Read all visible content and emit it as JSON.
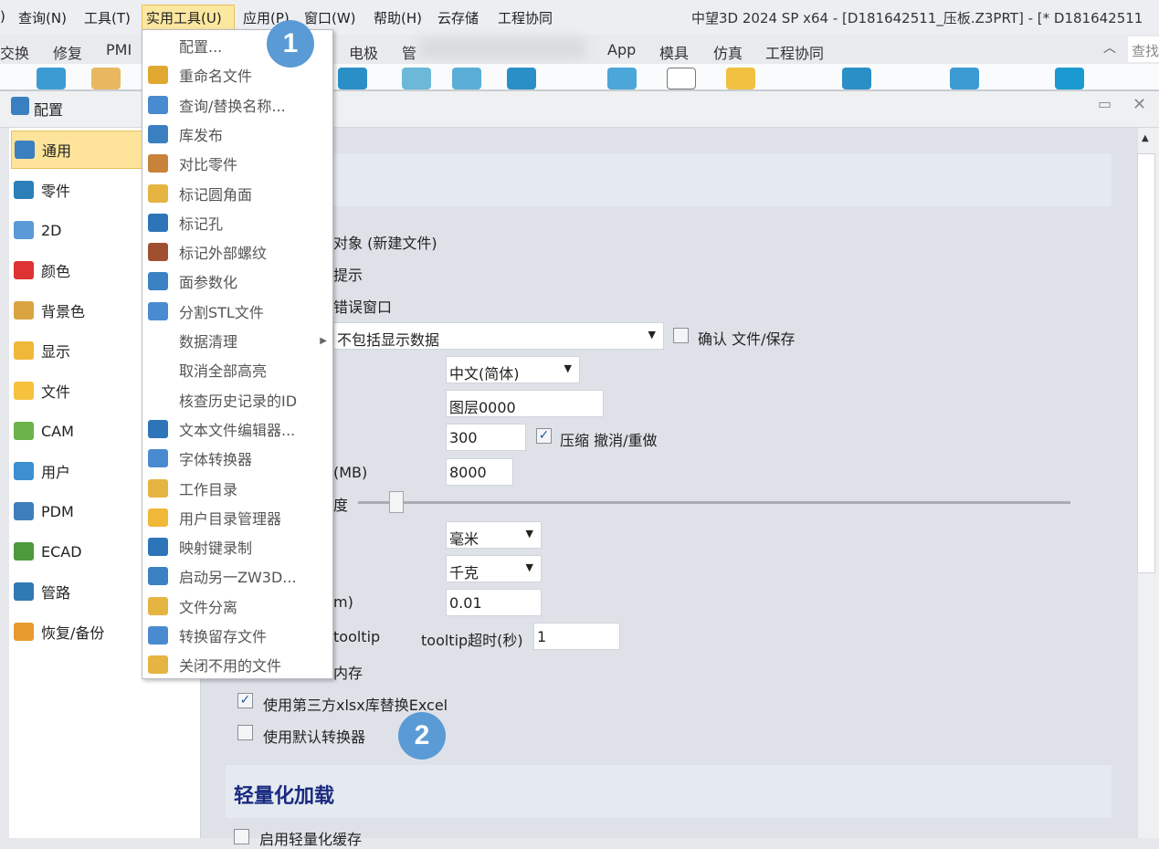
{
  "menubar": {
    "items": [
      ")",
      "查询(N)",
      "工具(T)",
      "实用工具(U)",
      "应用(P)",
      "窗口(W)",
      "帮助(H)",
      "云存储",
      "工程协同"
    ],
    "title": "中望3D 2024 SP x64 - [D181642511_压板.Z3PRT]  - [* D181642511"
  },
  "ribbon": {
    "tabs": [
      "交换",
      "修复",
      "PMI",
      "电极",
      "管",
      "App",
      "模具",
      "仿真",
      "工程协同"
    ],
    "search_placeholder": "查找"
  },
  "dialog": {
    "title": "配置"
  },
  "sidebar": {
    "items": [
      {
        "label": "通用",
        "icon": "general-icon",
        "color": "#3a7fc0"
      },
      {
        "label": "零件",
        "icon": "part-icon",
        "color": "#2b7fb8"
      },
      {
        "label": "2D",
        "icon": "2d-icon",
        "color": "#5a9ad6"
      },
      {
        "label": "颜色",
        "icon": "color-icon",
        "color": "#d33"
      },
      {
        "label": "背景色",
        "icon": "palette-icon",
        "color": "#d9a441"
      },
      {
        "label": "显示",
        "icon": "display-icon",
        "color": "#f0b838"
      },
      {
        "label": "文件",
        "icon": "folder-icon",
        "color": "#f6c23e"
      },
      {
        "label": "CAM",
        "icon": "cam-icon",
        "color": "#6bb34a"
      },
      {
        "label": "用户",
        "icon": "user-icon",
        "color": "#3c8fd0"
      },
      {
        "label": "PDM",
        "icon": "pdm-icon",
        "color": "#3d7fbd"
      },
      {
        "label": "ECAD",
        "icon": "ecad-icon",
        "color": "#4c9a3c"
      },
      {
        "label": "管路",
        "icon": "pipe-icon",
        "color": "#2f79b4"
      },
      {
        "label": "恢复/备份",
        "icon": "backup-icon",
        "color": "#e59b2d"
      }
    ]
  },
  "menu": {
    "items": [
      {
        "label": "配置...",
        "icon": ""
      },
      {
        "label": "重命名文件",
        "icon": "rename-icon",
        "color": "#e0a830"
      },
      {
        "label": "查询/替换名称...",
        "icon": "replace-name-icon",
        "color": "#4a8ad0"
      },
      {
        "label": "库发布",
        "icon": "library-publish-icon",
        "color": "#3a7fc0"
      },
      {
        "label": "对比零件",
        "icon": "compare-part-icon",
        "color": "#c9823a"
      },
      {
        "label": "标记圆角面",
        "icon": "mark-fillet-icon",
        "color": "#e6b440"
      },
      {
        "label": "标记孔",
        "icon": "mark-hole-icon",
        "color": "#2d74b8"
      },
      {
        "label": "标记外部螺纹",
        "icon": "mark-thread-icon",
        "color": "#a05030"
      },
      {
        "label": "面参数化",
        "icon": "face-param-icon",
        "color": "#3a82c4"
      },
      {
        "label": "分割STL文件",
        "icon": "split-stl-icon",
        "color": "#4a8ad0"
      },
      {
        "label": "数据清理",
        "icon": "",
        "submenu": true
      },
      {
        "label": "取消全部高亮",
        "icon": ""
      },
      {
        "label": "核查历史记录的ID",
        "icon": ""
      },
      {
        "label": "文本文件编辑器...",
        "icon": "text-editor-icon",
        "color": "#2d74b8"
      },
      {
        "label": "字体转换器",
        "icon": "font-converter-icon",
        "color": "#4a8ad0"
      },
      {
        "label": "工作目录",
        "icon": "work-dir-icon",
        "color": "#e6b440"
      },
      {
        "label": "用户目录管理器",
        "icon": "user-dir-icon",
        "color": "#f0b838"
      },
      {
        "label": "映射键录制",
        "icon": "keymap-record-icon",
        "color": "#2d74b8"
      },
      {
        "label": "启动另一ZW3D...",
        "icon": "launch-icon",
        "color": "#3a82c4"
      },
      {
        "label": "文件分离",
        "icon": "file-split-icon",
        "color": "#e6b440"
      },
      {
        "label": "转换留存文件",
        "icon": "convert-file-icon",
        "color": "#4a8ad0"
      },
      {
        "label": "关闭不用的文件",
        "icon": "close-unused-icon",
        "color": "#e6b440"
      }
    ]
  },
  "content": {
    "row1": "对象 (新建文件)",
    "row2": "提示",
    "row3": "错误窗口",
    "save_mode": "不包括显示数据",
    "confirm_save": {
      "label": "确认 文件/保存",
      "checked": false
    },
    "language": "中文(简体)",
    "layer": "图层0000",
    "undo_steps": "300",
    "compress_undo": {
      "label": "压缩 撤消/重做",
      "checked": true
    },
    "mem_label": "(MB)",
    "memory": "8000",
    "slider_label": "度",
    "slider_value": 0.05,
    "length_unit": "毫米",
    "mass_unit": "千克",
    "tol_label": "m)",
    "tolerance": "0.01",
    "tooltip_label": "tooltip",
    "tooltip_timeout_label": "tooltip超时(秒)",
    "tooltip_timeout": "1",
    "memory_label": "内存",
    "xlsx": {
      "label": "使用第三方xlsx库替换Excel",
      "checked": true
    },
    "default_converter": {
      "label": "使用默认转换器",
      "checked": false
    },
    "section2": "轻量化加载",
    "lightweight_cache": {
      "label": "启用轻量化缓存",
      "checked": false
    }
  },
  "badges": [
    "1",
    "2"
  ],
  "colors": {
    "highlight": "#fde49a",
    "badge": "#5b9bd5",
    "section_title": "#1a2a80"
  }
}
